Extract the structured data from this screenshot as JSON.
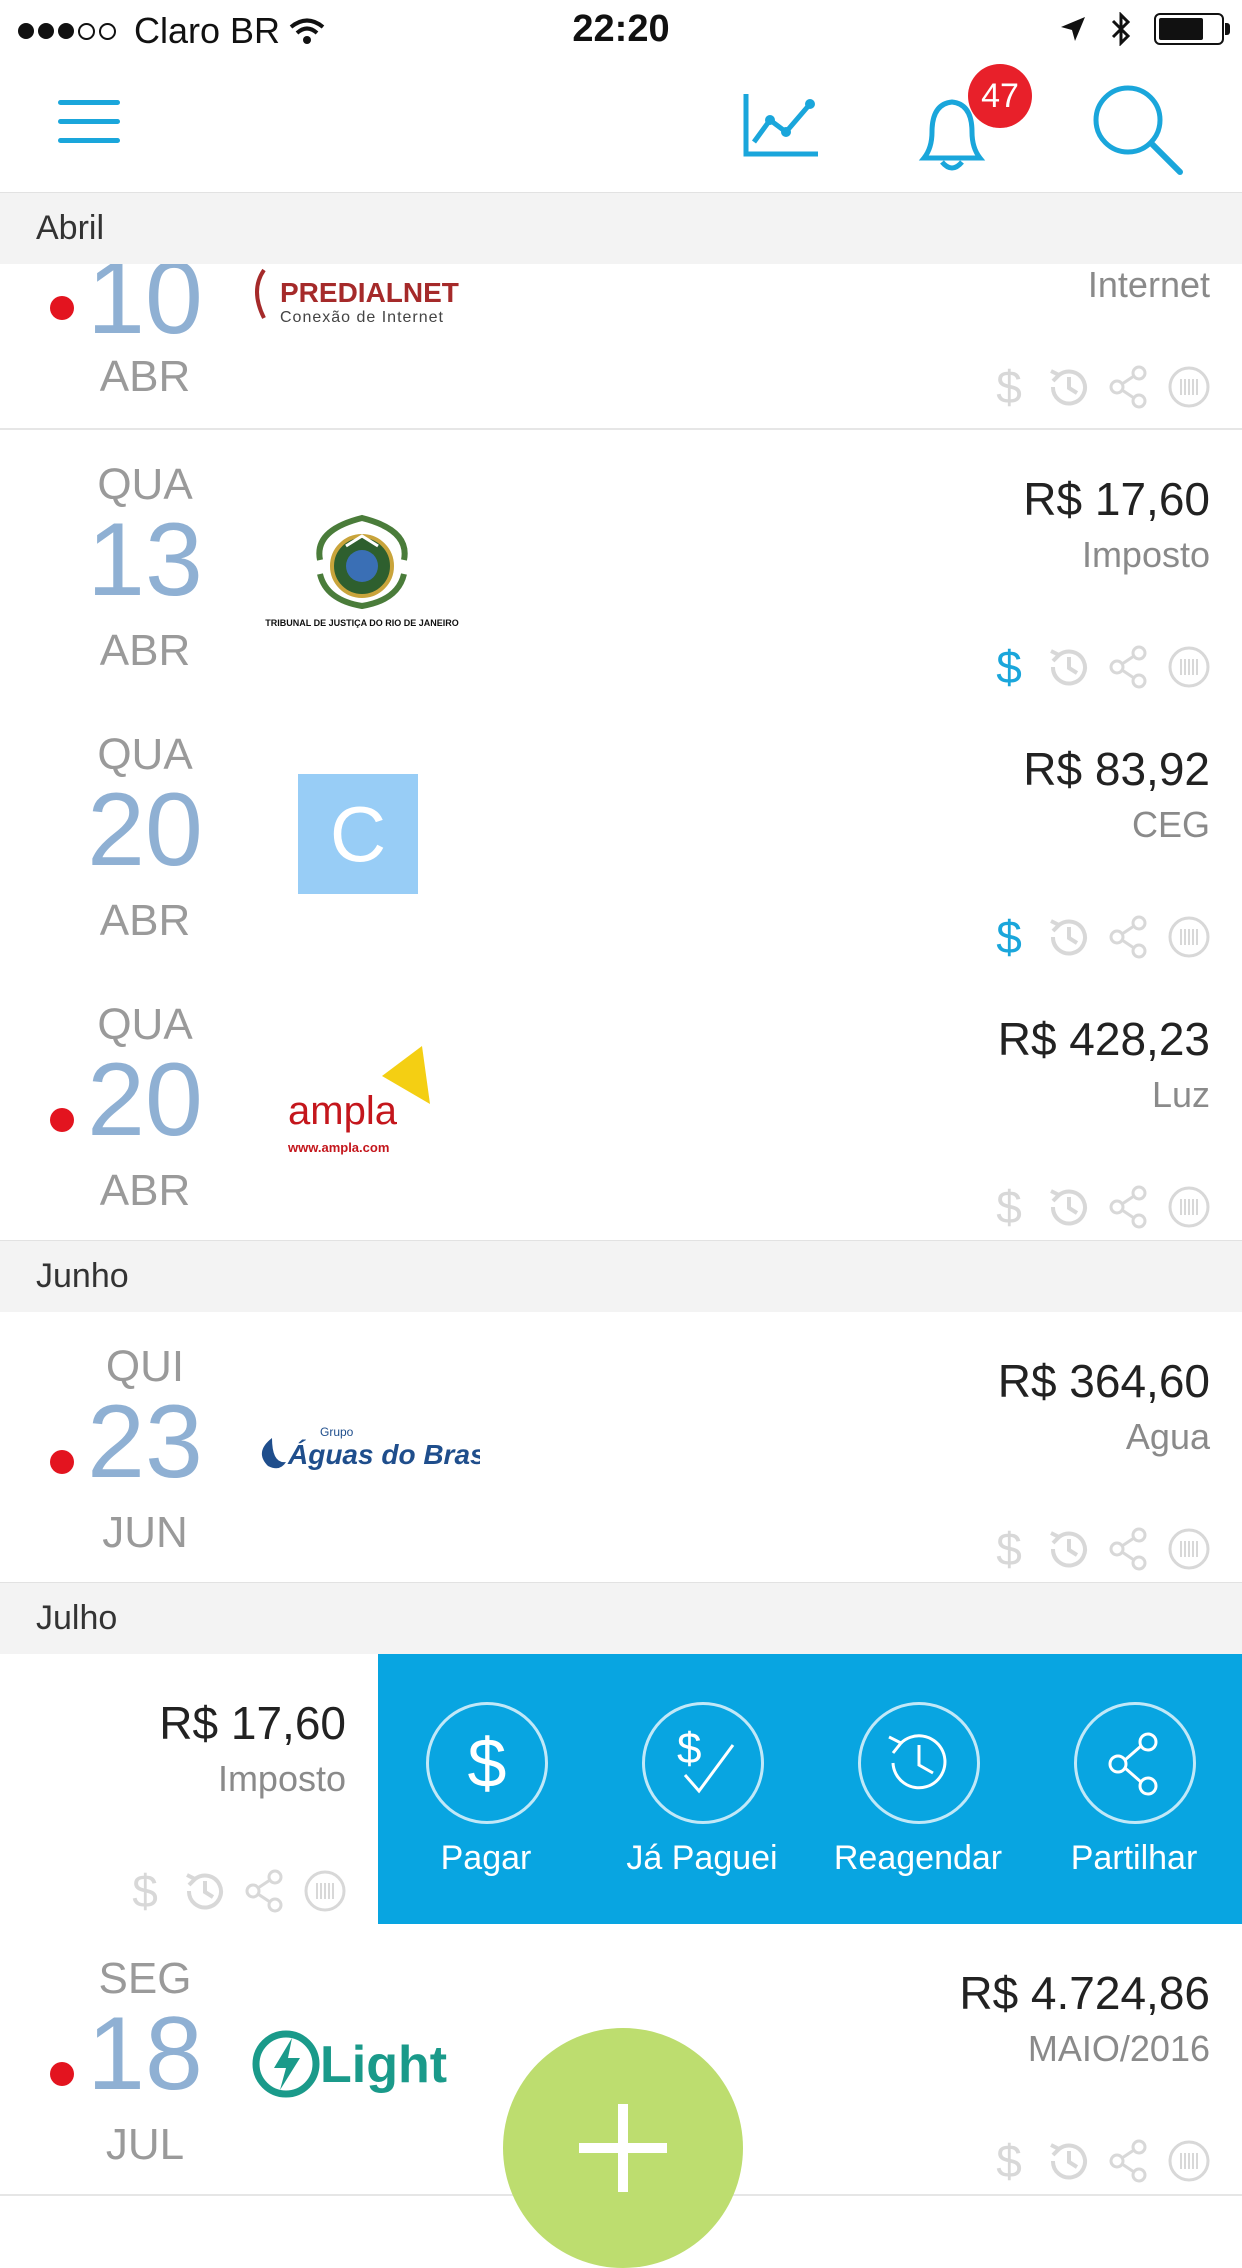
{
  "status_bar": {
    "carrier": "Claro BR",
    "time": "22:20"
  },
  "nav": {
    "notifications_count": "47"
  },
  "sections": [
    {
      "label": "Abril"
    },
    {
      "label": "Junho"
    },
    {
      "label": "Julho"
    }
  ],
  "bills": [
    {
      "weekday": "",
      "day": "10",
      "month": "ABR",
      "amount": "",
      "category": "Internet",
      "company": "PREDIALNET",
      "company_sub": "Conexão de Internet",
      "overdue": true,
      "pay_active": false
    },
    {
      "weekday": "QUA",
      "day": "13",
      "month": "ABR",
      "amount": "R$ 17,60",
      "category": "Imposto",
      "company": "TRIBUNAL DE JUSTIÇA DO RIO DE JANEIRO",
      "overdue": false,
      "pay_active": true
    },
    {
      "weekday": "QUA",
      "day": "20",
      "month": "ABR",
      "amount": "R$ 83,92",
      "category": "CEG",
      "company": "C",
      "overdue": false,
      "pay_active": true
    },
    {
      "weekday": "QUA",
      "day": "20",
      "month": "ABR",
      "amount": "R$ 428,23",
      "category": "Luz",
      "company": "ampla",
      "company_sub": "www.ampla.com",
      "overdue": true,
      "pay_active": false
    },
    {
      "weekday": "QUI",
      "day": "23",
      "month": "JUN",
      "amount": "R$ 364,60",
      "category": "Agua",
      "company": "Águas do Brasil",
      "company_sub": "Grupo",
      "overdue": true,
      "pay_active": false
    },
    {
      "amount": "R$ 17,60",
      "category": "Imposto"
    },
    {
      "weekday": "SEG",
      "day": "18",
      "month": "JUL",
      "amount": "R$ 4.724,86",
      "category": "MAIO/2016",
      "company": "Light",
      "overdue": true,
      "pay_active": false
    }
  ],
  "swipe_actions": [
    {
      "label": "Pagar",
      "icon": "dollar-icon"
    },
    {
      "label": "Já Paguei",
      "icon": "dollar-check-icon"
    },
    {
      "label": "Reagendar",
      "icon": "history-icon"
    },
    {
      "label": "Partilhar",
      "icon": "share-icon"
    }
  ],
  "colors": {
    "accent": "#1aa6db",
    "swipe_panel": "#08a5e1",
    "overdue_dot": "#e3141f",
    "date": "#8fb0d3",
    "fab": "#bddd6f",
    "badge": "#e8202a"
  }
}
